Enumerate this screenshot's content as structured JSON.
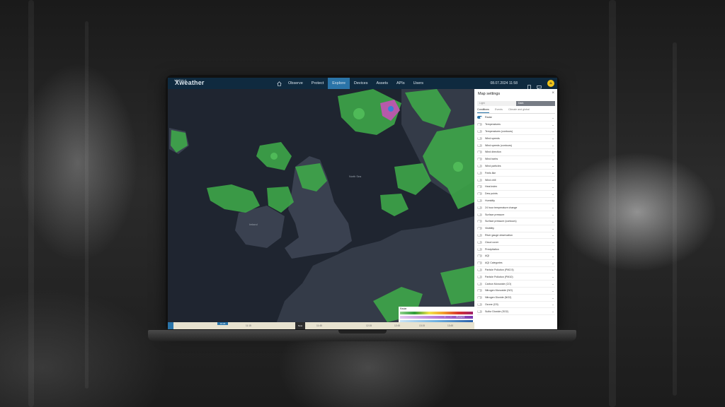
{
  "app": {
    "logo_small": "VAISALA",
    "logo": "Xweather",
    "nav": [
      "Observe",
      "Protect",
      "Explore",
      "Devices",
      "Assets",
      "APIs",
      "Users"
    ],
    "active_nav": "Explore",
    "datetime": "08.07.2024 11:58",
    "avatar_initials": "JL"
  },
  "icons": {
    "home": "home-icon",
    "book": "book-icon",
    "chat": "chat-icon",
    "close": "close-icon",
    "chevron": "chevron-down-icon"
  },
  "map": {
    "labels": [
      "North Sea",
      "Ireland"
    ],
    "legend_title": "Radar",
    "controls": [
      "+",
      "−",
      "Reset"
    ]
  },
  "timeline": {
    "current": "10:45",
    "now_label": "Now",
    "ticks": [
      "11:15",
      "11:45",
      "12:15",
      "12:45",
      "13:15",
      "13:45"
    ]
  },
  "panel": {
    "title": "Map settings",
    "theme_light": "Light",
    "theme_dark": "Dark",
    "tabs": [
      "Conditions",
      "Events",
      "Climate and global"
    ],
    "layers": [
      {
        "name": "Radar",
        "on": true
      },
      {
        "name": "Temperatures",
        "on": false
      },
      {
        "name": "Temperatures (contours)",
        "on": false
      },
      {
        "name": "Wind speeds",
        "on": false
      },
      {
        "name": "Wind speeds (contours)",
        "on": false
      },
      {
        "name": "Wind direction",
        "on": false
      },
      {
        "name": "Wind barbs",
        "on": false
      },
      {
        "name": "Wind particles",
        "on": false
      },
      {
        "name": "Feels like",
        "on": false
      },
      {
        "name": "Wind chill",
        "on": false
      },
      {
        "name": "Heat index",
        "on": false
      },
      {
        "name": "Dew points",
        "on": false
      },
      {
        "name": "Humidity",
        "on": false
      },
      {
        "name": "24 hour temperature change",
        "on": false
      },
      {
        "name": "Surface pressure",
        "on": false
      },
      {
        "name": "Surface pressure (contours)",
        "on": false
      },
      {
        "name": "Visibility",
        "on": false
      },
      {
        "name": "River gauge observation",
        "on": false
      },
      {
        "name": "Cloud cover",
        "on": false
      },
      {
        "name": "Precipitation",
        "on": false
      },
      {
        "name": "AQI",
        "on": false
      },
      {
        "name": "AQI Categories",
        "on": false
      },
      {
        "name": "Particle Pollution (PM2.5)",
        "on": false
      },
      {
        "name": "Particle Pollution (PM10)",
        "on": false
      },
      {
        "name": "Carbon Monoxide (CO)",
        "on": false
      },
      {
        "name": "Nitrogen Monoxide (NO)",
        "on": false
      },
      {
        "name": "Nitrogen Dioxide (NO2)",
        "on": false
      },
      {
        "name": "Ozone (O3)",
        "on": false
      },
      {
        "name": "Sulfur Dioxide (SO2)",
        "on": false
      }
    ]
  },
  "colors": {
    "topbar": "#0f2a3f",
    "accent": "#2a74a8",
    "map_bg": "#1f2530",
    "land": "#3a4150",
    "radar": "#3fae4a",
    "avatar": "#f2c418"
  }
}
